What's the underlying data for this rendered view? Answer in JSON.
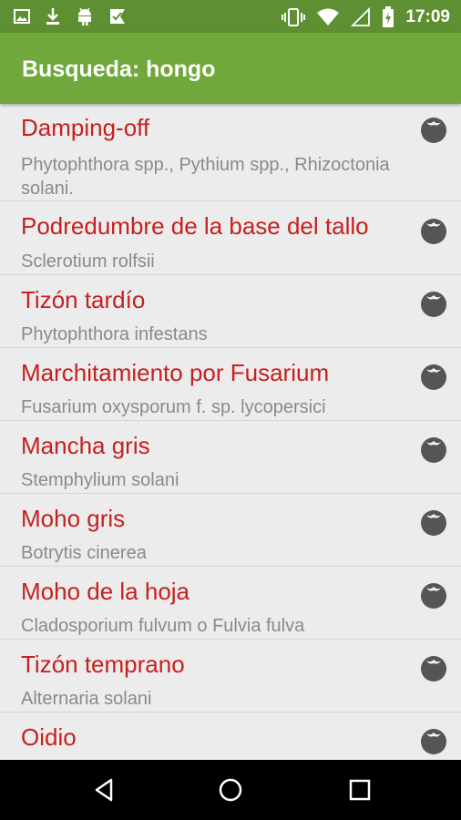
{
  "status_bar": {
    "time": "17:09",
    "left_icons": [
      "image-icon",
      "download-icon",
      "android-icon",
      "checkmark-flag-icon"
    ],
    "right_icons": [
      "vibrate-icon",
      "wifi-icon",
      "signal-icon",
      "battery-charging-icon"
    ]
  },
  "app_bar": {
    "title": "Busqueda: hongo",
    "color": "#70a83b"
  },
  "results": [
    {
      "title": "Damping-off",
      "subtitle": "Phytophthora spp., Pythium spp., Rhizoctonia solani.",
      "icon": "tomato-icon"
    },
    {
      "title": "Podredumbre de la base del tallo",
      "subtitle": "Sclerotium rolfsii",
      "icon": "tomato-icon"
    },
    {
      "title": "Tizón tardío",
      "subtitle": "Phytophthora infestans",
      "icon": "tomato-icon"
    },
    {
      "title": "Marchitamiento por Fusarium",
      "subtitle": "Fusarium oxysporum f. sp. lycopersici",
      "icon": "tomato-icon"
    },
    {
      "title": "Mancha gris",
      "subtitle": "Stemphylium solani",
      "icon": "tomato-icon"
    },
    {
      "title": "Moho gris",
      "subtitle": "Botrytis cinerea",
      "icon": "tomato-icon"
    },
    {
      "title": "Moho de la hoja",
      "subtitle": "Cladosporium fulvum o Fulvia fulva",
      "icon": "tomato-icon"
    },
    {
      "title": "Tizón temprano",
      "subtitle": "Alternaria solani",
      "icon": "tomato-icon"
    },
    {
      "title": "Oidio",
      "subtitle": "",
      "icon": "tomato-icon"
    }
  ],
  "nav_bar": {
    "buttons": [
      "back-icon",
      "home-icon",
      "recents-icon"
    ]
  },
  "colors": {
    "title_red": "#c62020",
    "subtitle_gray": "#8a8a8a",
    "statusbar_green": "#5f8f33"
  }
}
